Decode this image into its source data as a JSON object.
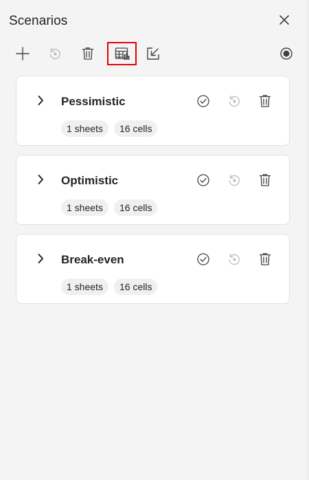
{
  "pane": {
    "title": "Scenarios",
    "close_icon": "close-icon"
  },
  "toolbar": {
    "buttons": [
      {
        "name": "add-scenario-button",
        "icon": "plus-icon",
        "enabled": true
      },
      {
        "name": "revert-button",
        "icon": "undo-circle-icon",
        "enabled": false
      },
      {
        "name": "delete-button",
        "icon": "trash-icon",
        "enabled": true
      },
      {
        "name": "summary-table-button",
        "icon": "table-chart-icon",
        "enabled": true,
        "highlighted": true
      },
      {
        "name": "apply-to-sheet-button",
        "icon": "arrow-into-box-icon",
        "enabled": true
      },
      {
        "name": "record-button",
        "icon": "record-icon",
        "enabled": true
      }
    ]
  },
  "scenarios": [
    {
      "name": "Pessimistic",
      "sheets": "1 sheets",
      "cells": "16 cells"
    },
    {
      "name": "Optimistic",
      "sheets": "1 sheets",
      "cells": "16 cells"
    },
    {
      "name": "Break-even",
      "sheets": "1 sheets",
      "cells": "16 cells"
    }
  ],
  "colors": {
    "background": "#f4f4f4",
    "card": "#ffffff",
    "icon": "#424242",
    "icon_disabled": "#bdbdbd",
    "highlight": "#e0000b",
    "pill": "#f0f0f0"
  }
}
